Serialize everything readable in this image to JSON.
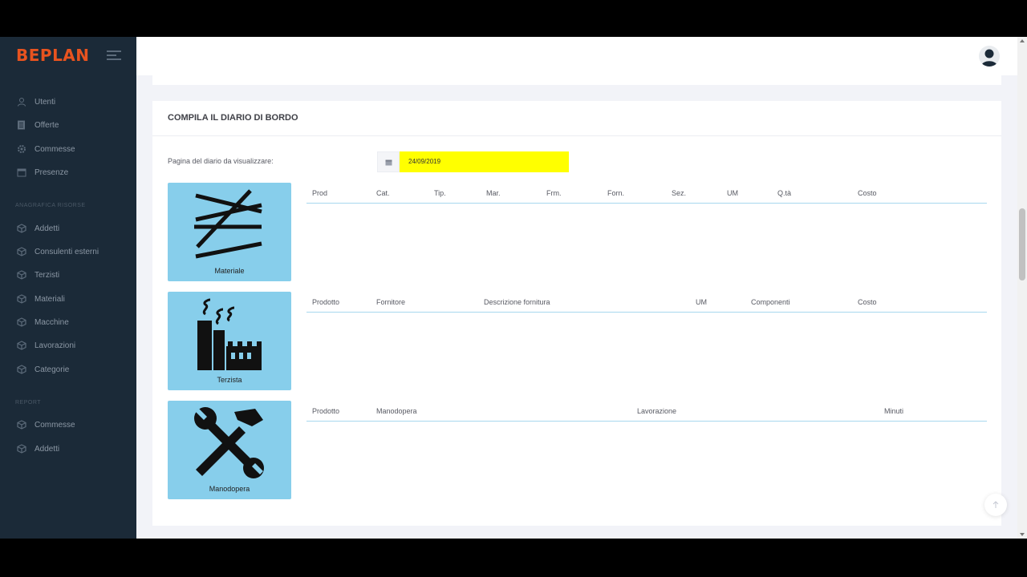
{
  "app": {
    "logo": "BEPLAN",
    "accent": "#e8531f"
  },
  "sidebar": {
    "items_main": [
      {
        "label": "Utenti",
        "icon": "user-icon"
      },
      {
        "label": "Offerte",
        "icon": "document-icon"
      },
      {
        "label": "Commesse",
        "icon": "gear-icon"
      },
      {
        "label": "Presenze",
        "icon": "calendar-icon"
      }
    ],
    "section_resources": "ANAGRAFICA RISORSE",
    "items_resources": [
      {
        "label": "Addetti",
        "icon": "cube-icon"
      },
      {
        "label": "Consulenti esterni",
        "icon": "cube-icon"
      },
      {
        "label": "Terzisti",
        "icon": "cube-icon"
      },
      {
        "label": "Materiali",
        "icon": "cube-icon"
      },
      {
        "label": "Macchine",
        "icon": "cube-icon"
      },
      {
        "label": "Lavorazioni",
        "icon": "cube-icon"
      },
      {
        "label": "Categorie",
        "icon": "cube-icon"
      }
    ],
    "section_report": "REPORT",
    "items_report": [
      {
        "label": "Commesse",
        "icon": "cube-icon"
      },
      {
        "label": "Addetti",
        "icon": "cube-icon"
      }
    ]
  },
  "card": {
    "title": "COMPILA IL DIARIO DI BORDO",
    "date_label": "Pagina del diario da visualizzare:",
    "date_value": "24/09/2019",
    "date_highlight": "#ffff00"
  },
  "tiles": [
    {
      "label": "Materiale",
      "icon": "materials-icon"
    },
    {
      "label": "Terzista",
      "icon": "factory-icon"
    },
    {
      "label": "Manodopera",
      "icon": "tools-icon"
    }
  ],
  "tables": {
    "material": [
      "Prod",
      "Cat.",
      "Tip.",
      "Mar.",
      "Frm.",
      "Forn.",
      "Sez.",
      "UM",
      "Q.tà",
      "Costo"
    ],
    "subcontractor": [
      "Prodotto",
      "Fornitore",
      "Descrizione fornitura",
      "UM",
      "Componenti",
      "Costo"
    ],
    "labor": [
      "Prodotto",
      "Manodopera",
      "Lavorazione",
      "Minuti"
    ]
  },
  "tile_color": "#87ceeb"
}
